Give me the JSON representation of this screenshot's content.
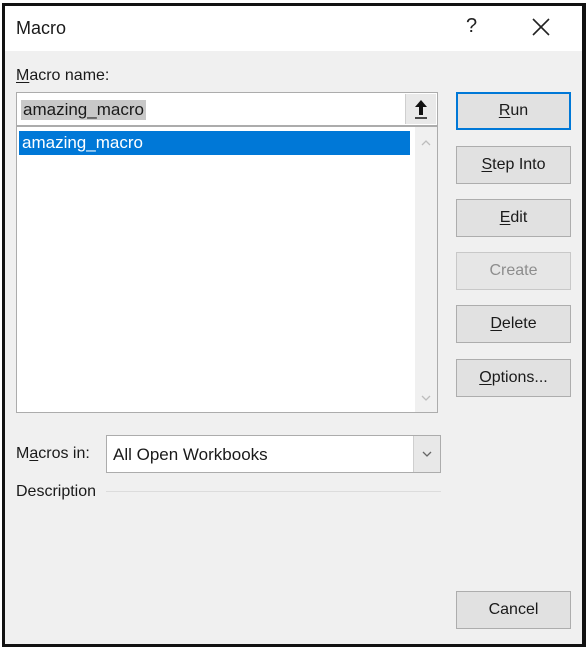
{
  "window": {
    "title": "Macro",
    "help_label": "?",
    "icons": {
      "help": "question-mark-icon",
      "close": "close-x-icon"
    }
  },
  "macro_name": {
    "label_underlined": "M",
    "label_rest": "acro name:",
    "value": "amazing_macro",
    "up_button_icon": "arrow-up-icon"
  },
  "macro_list": {
    "items": [
      {
        "label": "amazing_macro",
        "selected": true
      }
    ],
    "scrollbar_icons": {
      "up": "chevron-up-icon",
      "down": "chevron-down-icon"
    }
  },
  "buttons": {
    "run": {
      "underlined": "R",
      "rest": "un",
      "default": true
    },
    "step_into": {
      "underlined": "S",
      "rest": "tep Into"
    },
    "edit": {
      "underlined": "E",
      "rest": "dit"
    },
    "create": {
      "label": "Create",
      "disabled": true
    },
    "delete": {
      "underlined": "D",
      "rest": "elete"
    },
    "options": {
      "underlined": "O",
      "rest": "ptions..."
    },
    "cancel": {
      "label": "Cancel"
    }
  },
  "macros_in": {
    "label_pre": "M",
    "label_underlined": "a",
    "label_rest": "cros in:",
    "selected": "All Open Workbooks"
  },
  "description": {
    "label": "Description",
    "text": ""
  },
  "colors": {
    "selection": "#0078d7",
    "default_button_border": "#0078d7",
    "dialog_background": "#f0f0f0"
  }
}
